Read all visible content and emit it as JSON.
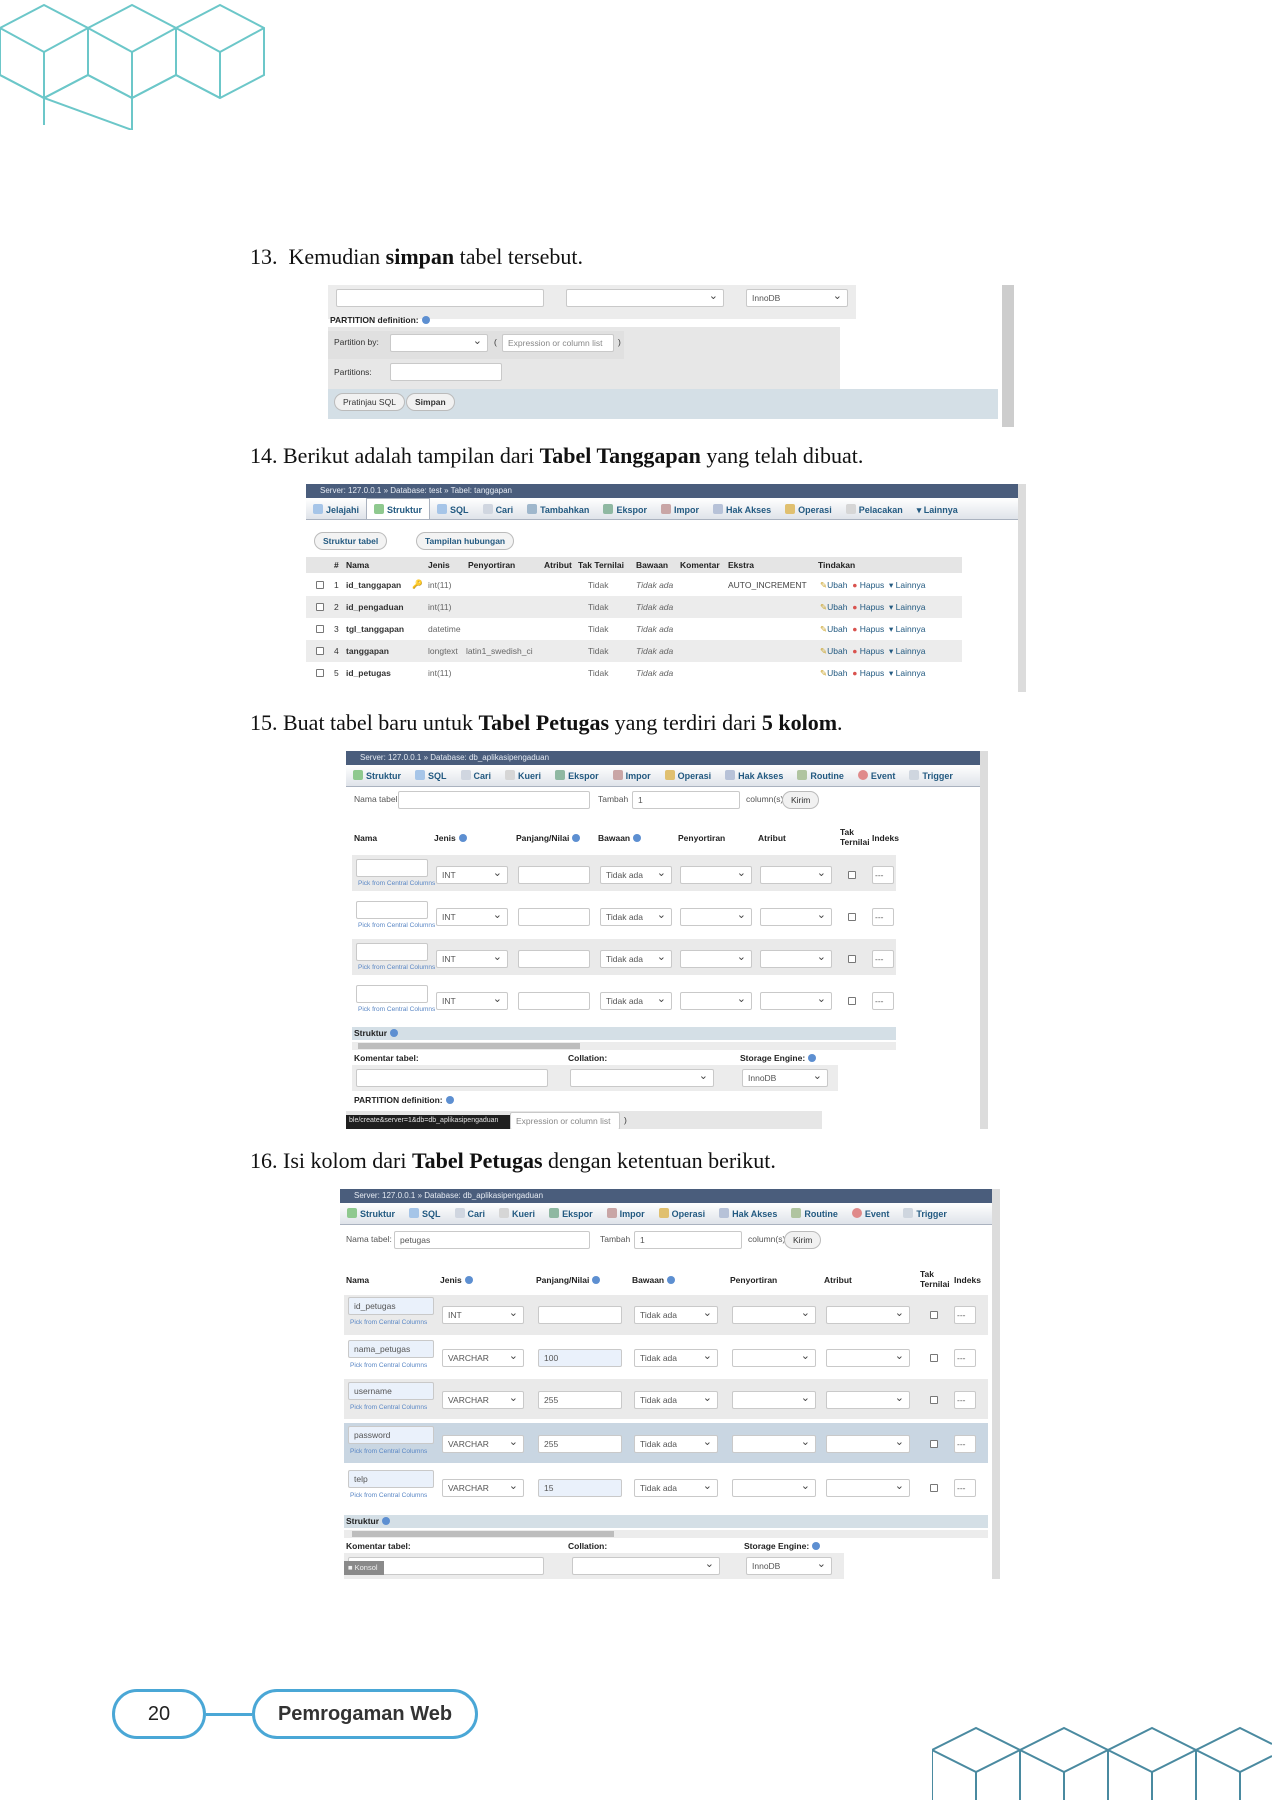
{
  "steps": [
    {
      "num": "13.",
      "pre": "Kemudian ",
      "bold": "simpan",
      "post": " tabel tersebut."
    },
    {
      "num": "14.",
      "pre": "Berikut adalah tampilan dari ",
      "bold": "Tabel Tanggapan",
      "post": " yang telah dibuat."
    },
    {
      "num": "15.",
      "pre": "Buat tabel baru untuk ",
      "bold": "Tabel Petugas",
      "mid": " yang terdiri dari ",
      "bold2": "5 kolom",
      "post": "."
    },
    {
      "num": "16.",
      "pre": "Isi kolom dari ",
      "bold": "Tabel Petugas",
      "post": " dengan ketentuan berikut."
    }
  ],
  "shot1": {
    "engine": "InnoDB",
    "partition_definition": "PARTITION definition:",
    "partition_by": "Partition by:",
    "expression_placeholder": "Expression or column list",
    "open_paren": "(",
    "close_paren": ")",
    "partitions": "Partitions:",
    "preview_sql": "Pratinjau SQL",
    "save": "Simpan"
  },
  "shot2": {
    "breadcrumb": "Server: 127.0.0.1 » Database: test » Tabel: tanggapan",
    "tabs": [
      "Jelajahi",
      "Struktur",
      "SQL",
      "Cari",
      "Tambahkan",
      "Ekspor",
      "Impor",
      "Hak Akses",
      "Operasi",
      "Pelacakan",
      "Lainnya"
    ],
    "subtabs": [
      "Struktur tabel",
      "Tampilan hubungan"
    ],
    "columns": [
      "#",
      "Nama",
      "Jenis",
      "Penyortiran",
      "Atribut",
      "Tak Ternilai",
      "Bawaan",
      "Komentar",
      "Ekstra",
      "Tindakan"
    ],
    "rows": [
      {
        "num": "1",
        "name": "id_tanggapan",
        "type": "int(11)",
        "collation": "",
        "null": "Tidak",
        "default": "Tidak ada",
        "extra": "AUTO_INCREMENT"
      },
      {
        "num": "2",
        "name": "id_pengaduan",
        "type": "int(11)",
        "collation": "",
        "null": "Tidak",
        "default": "Tidak ada",
        "extra": ""
      },
      {
        "num": "3",
        "name": "tgl_tanggapan",
        "type": "datetime",
        "collation": "",
        "null": "Tidak",
        "default": "Tidak ada",
        "extra": ""
      },
      {
        "num": "4",
        "name": "tanggapan",
        "type": "longtext",
        "collation": "latin1_swedish_ci",
        "null": "Tidak",
        "default": "Tidak ada",
        "extra": ""
      },
      {
        "num": "5",
        "name": "id_petugas",
        "type": "int(11)",
        "collation": "",
        "null": "Tidak",
        "default": "Tidak ada",
        "extra": ""
      }
    ],
    "actions": [
      "Ubah",
      "Hapus",
      "Lainnya"
    ]
  },
  "shot3": {
    "breadcrumb": "Server: 127.0.0.1 » Database: db_aplikasipengaduan",
    "tabs": [
      "Struktur",
      "SQL",
      "Cari",
      "Kueri",
      "Ekspor",
      "Impor",
      "Operasi",
      "Hak Akses",
      "Routine",
      "Event",
      "Trigger"
    ],
    "table_name_label": "Nama tabel:",
    "table_name": "",
    "add_label": "Tambah",
    "add_count": "1",
    "columns_label": "column(s)",
    "go": "Kirim",
    "headers": [
      "Nama",
      "Jenis",
      "Panjang/Nilai",
      "Bawaan",
      "Penyortiran",
      "Atribut",
      "Tak Ternilai",
      "Indeks"
    ],
    "rows": [
      {
        "name": "",
        "type": "INT",
        "length": "",
        "default": "Tidak ada"
      },
      {
        "name": "",
        "type": "INT",
        "length": "",
        "default": "Tidak ada"
      },
      {
        "name": "",
        "type": "INT",
        "length": "",
        "default": "Tidak ada"
      },
      {
        "name": "",
        "type": "INT",
        "length": "",
        "default": "Tidak ada"
      }
    ],
    "pick_central": "Pick from Central Columns",
    "index_value": "---",
    "structure": "Struktur",
    "table_comment": "Komentar tabel:",
    "collation": "Collation:",
    "storage_engine": "Storage Engine:",
    "engine": "InnoDB",
    "partition_definition": "PARTITION definition:",
    "status_url": "ble/create&server=1&db=db_aplikasipengaduan",
    "expression_placeholder": "Expression or column list",
    "close_paren": ")"
  },
  "shot4": {
    "breadcrumb": "Server: 127.0.0.1 » Database: db_aplikasipengaduan",
    "tabs": [
      "Struktur",
      "SQL",
      "Cari",
      "Kueri",
      "Ekspor",
      "Impor",
      "Operasi",
      "Hak Akses",
      "Routine",
      "Event",
      "Trigger"
    ],
    "table_name_label": "Nama tabel:",
    "table_name": "petugas",
    "add_label": "Tambah",
    "add_count": "1",
    "columns_label": "column(s)",
    "go": "Kirim",
    "headers": [
      "Nama",
      "Jenis",
      "Panjang/Nilai",
      "Bawaan",
      "Penyortiran",
      "Atribut",
      "Tak Ternilai",
      "Indeks"
    ],
    "rows": [
      {
        "name": "id_petugas",
        "type": "INT",
        "length": "",
        "default": "Tidak ada"
      },
      {
        "name": "nama_petugas",
        "type": "VARCHAR",
        "length": "100",
        "default": "Tidak ada"
      },
      {
        "name": "username",
        "type": "VARCHAR",
        "length": "255",
        "default": "Tidak ada"
      },
      {
        "name": "password",
        "type": "VARCHAR",
        "length": "255",
        "default": "Tidak ada"
      },
      {
        "name": "telp",
        "type": "VARCHAR",
        "length": "15",
        "default": "Tidak ada"
      }
    ],
    "pick_central": "Pick from Central Columns",
    "index_value": "---",
    "structure": "Struktur",
    "table_comment": "Komentar tabel:",
    "collation": "Collation:",
    "storage_engine": "Storage Engine:",
    "engine": "InnoDB",
    "console": "Konsol"
  },
  "footer": {
    "page_number": "20",
    "title": "Pemrogaman Web"
  }
}
